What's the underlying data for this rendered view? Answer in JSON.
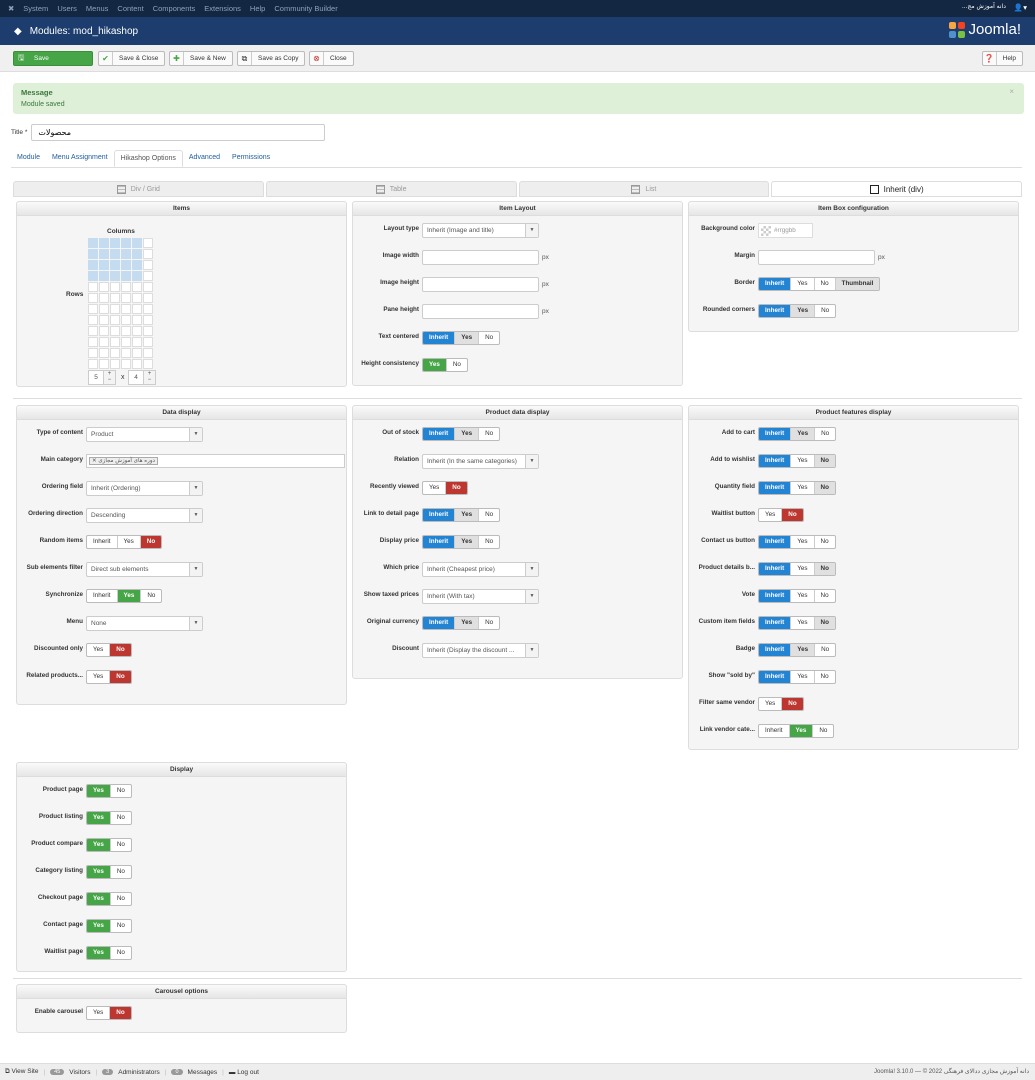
{
  "topnav": {
    "items": [
      "System",
      "Users",
      "Menus",
      "Content",
      "Components",
      "Extensions",
      "Help",
      "Community Builder"
    ],
    "site_name": "دانه آموزش مج...",
    "user_icon": "user-icon"
  },
  "header": {
    "title": "Modules: mod_hikashop",
    "logo": "Joomla!"
  },
  "toolbar": {
    "save": "Save",
    "save_close": "Save & Close",
    "save_new": "Save & New",
    "save_copy": "Save as Copy",
    "close": "Close",
    "help": "Help"
  },
  "message": {
    "heading": "Message",
    "text": "Module saved",
    "close": "×"
  },
  "title_field": {
    "label": "Title *",
    "value": "محصولات"
  },
  "tabs": [
    "Module",
    "Menu Assignment",
    "Hikashop Options",
    "Advanced",
    "Permissions"
  ],
  "active_tab": 2,
  "layout_tabs": [
    "Div / Grid",
    "Table",
    "List",
    "Inherit (div)"
  ],
  "active_layout_tab": 3,
  "colors": {
    "blue": "#2384d3",
    "green": "#46a546",
    "red": "#bd362f",
    "topbar": "#132743",
    "header": "#1c3d6e"
  },
  "items": {
    "title": "Items",
    "columns_label": "Columns",
    "rows_label": "Rows",
    "columns": 5,
    "rows": 4,
    "grid_cols": 6,
    "grid_rows": 12,
    "x": "x",
    "plus": "+",
    "minus": "−"
  },
  "item_layout": {
    "title": "Item Layout",
    "rows": [
      {
        "label": "Layout type",
        "type": "select",
        "value": "Inherit (Image and title)"
      },
      {
        "label": "Image width",
        "type": "input",
        "unit": "px"
      },
      {
        "label": "Image height",
        "type": "input",
        "unit": "px"
      },
      {
        "label": "Pane height",
        "type": "input",
        "unit": "px"
      },
      {
        "label": "Text centered",
        "type": "toggle",
        "options": [
          "Inherit",
          "Yes",
          "No"
        ],
        "selected": 0,
        "hint": 1
      },
      {
        "label": "Height consistency",
        "type": "toggle",
        "options": [
          "Yes",
          "No"
        ],
        "selected": 0
      }
    ]
  },
  "item_box": {
    "title": "Item Box configuration",
    "rows": [
      {
        "label": "Background color",
        "type": "color",
        "placeholder": "#rrggbb"
      },
      {
        "label": "Margin",
        "type": "input",
        "unit": "px"
      },
      {
        "label": "Border",
        "type": "toggle",
        "options": [
          "Inherit",
          "Yes",
          "No",
          "Thumbnail"
        ],
        "selected": 0,
        "hint": 3
      },
      {
        "label": "Rounded corners",
        "type": "toggle",
        "options": [
          "Inherit",
          "Yes",
          "No"
        ],
        "selected": 0,
        "hint": 1
      }
    ]
  },
  "data_display": {
    "title": "Data display",
    "rows": [
      {
        "label": "Type of content",
        "type": "select",
        "value": "Product"
      },
      {
        "label": "Main category",
        "type": "tags",
        "value": "دوره های آموزش مجازی"
      },
      {
        "label": "Ordering field",
        "type": "select",
        "value": "Inherit (Ordering)"
      },
      {
        "label": "Ordering direction",
        "type": "select",
        "value": "Descending"
      },
      {
        "label": "Random items",
        "type": "toggle",
        "options": [
          "Inherit",
          "Yes",
          "No"
        ],
        "selected": 2
      },
      {
        "label": "Sub elements filter",
        "type": "select",
        "value": "Direct sub elements"
      },
      {
        "label": "Synchronize",
        "type": "toggle",
        "options": [
          "Inherit",
          "Yes",
          "No"
        ],
        "selected": 1
      },
      {
        "label": "Menu",
        "type": "select",
        "value": "None"
      },
      {
        "label": "Discounted only",
        "type": "toggle",
        "options": [
          "Yes",
          "No"
        ],
        "selected": 1
      },
      {
        "label": "Related products...",
        "type": "toggle",
        "options": [
          "Yes",
          "No"
        ],
        "selected": 1
      }
    ]
  },
  "product_data": {
    "title": "Product data display",
    "rows": [
      {
        "label": "Out of stock",
        "type": "toggle",
        "options": [
          "Inherit",
          "Yes",
          "No"
        ],
        "selected": 0,
        "hint": 1
      },
      {
        "label": "Relation",
        "type": "select",
        "value": "Inherit (In the same categories)"
      },
      {
        "label": "Recently viewed",
        "type": "toggle",
        "options": [
          "Yes",
          "No"
        ],
        "selected": 1
      },
      {
        "label": "Link to detail page",
        "type": "toggle",
        "options": [
          "Inherit",
          "Yes",
          "No"
        ],
        "selected": 0,
        "hint": 1
      },
      {
        "label": "Display price",
        "type": "toggle",
        "options": [
          "Inherit",
          "Yes",
          "No"
        ],
        "selected": 0,
        "hint": 1
      },
      {
        "label": "Which price",
        "type": "select",
        "value": "Inherit (Cheapest price)"
      },
      {
        "label": "Show taxed prices",
        "type": "select",
        "value": "Inherit (With tax)"
      },
      {
        "label": "Original currency",
        "type": "toggle",
        "options": [
          "Inherit",
          "Yes",
          "No"
        ],
        "selected": 0,
        "hint": 1
      },
      {
        "label": "Discount",
        "type": "select",
        "value": "Inherit (Display the discount ..."
      }
    ]
  },
  "features": {
    "title": "Product features display",
    "rows": [
      {
        "label": "Add to cart",
        "type": "toggle",
        "options": [
          "Inherit",
          "Yes",
          "No"
        ],
        "selected": 0,
        "hint": 1
      },
      {
        "label": "Add to wishlist",
        "type": "toggle",
        "options": [
          "Inherit",
          "Yes",
          "No"
        ],
        "selected": 0,
        "hint": 2
      },
      {
        "label": "Quantity field",
        "type": "toggle",
        "options": [
          "Inherit",
          "Yes",
          "No"
        ],
        "selected": 0,
        "hint": 2
      },
      {
        "label": "Waitlist button",
        "type": "toggle",
        "options": [
          "Yes",
          "No"
        ],
        "selected": 1
      },
      {
        "label": "Contact us button",
        "type": "toggle",
        "options": [
          "Inherit",
          "Yes",
          "No"
        ],
        "selected": 0
      },
      {
        "label": "Product details b...",
        "type": "toggle",
        "options": [
          "Inherit",
          "Yes",
          "No"
        ],
        "selected": 0,
        "hint": 2
      },
      {
        "label": "Vote",
        "type": "toggle",
        "options": [
          "Inherit",
          "Yes",
          "No"
        ],
        "selected": 0
      },
      {
        "label": "Custom item fields",
        "type": "toggle",
        "options": [
          "Inherit",
          "Yes",
          "No"
        ],
        "selected": 0,
        "hint": 2
      },
      {
        "label": "Badge",
        "type": "toggle",
        "options": [
          "Inherit",
          "Yes",
          "No"
        ],
        "selected": 0,
        "hint": 1
      },
      {
        "label": "Show \"sold by\"",
        "type": "toggle",
        "options": [
          "Inherit",
          "Yes",
          "No"
        ],
        "selected": 0
      },
      {
        "label": "Filter same vendor",
        "type": "toggle",
        "options": [
          "Yes",
          "No"
        ],
        "selected": 1
      },
      {
        "label": "Link vendor cate...",
        "type": "toggle",
        "options": [
          "Inherit",
          "Yes",
          "No"
        ],
        "selected": 1
      }
    ]
  },
  "display": {
    "title": "Display",
    "rows": [
      {
        "label": "Product page",
        "type": "toggle",
        "options": [
          "Yes",
          "No"
        ],
        "selected": 0
      },
      {
        "label": "Product listing",
        "type": "toggle",
        "options": [
          "Yes",
          "No"
        ],
        "selected": 0
      },
      {
        "label": "Product compare",
        "type": "toggle",
        "options": [
          "Yes",
          "No"
        ],
        "selected": 0
      },
      {
        "label": "Category listing",
        "type": "toggle",
        "options": [
          "Yes",
          "No"
        ],
        "selected": 0
      },
      {
        "label": "Checkout page",
        "type": "toggle",
        "options": [
          "Yes",
          "No"
        ],
        "selected": 0
      },
      {
        "label": "Contact page",
        "type": "toggle",
        "options": [
          "Yes",
          "No"
        ],
        "selected": 0
      },
      {
        "label": "Waitlist page",
        "type": "toggle",
        "options": [
          "Yes",
          "No"
        ],
        "selected": 0
      }
    ]
  },
  "carousel": {
    "title": "Carousel options",
    "rows": [
      {
        "label": "Enable carousel",
        "type": "toggle",
        "options": [
          "Yes",
          "No"
        ],
        "selected": 1
      }
    ]
  },
  "footer": {
    "view_site": "View Site",
    "visitors_count": "45",
    "visitors": "Visitors",
    "admins_count": "3",
    "admins": "Administrators",
    "messages_count": "0",
    "messages": "Messages",
    "logout": "Log out",
    "version": "Joomla! 3.10.0 — © 2022 دانه آموزش مجازی ددالای فرهنگی"
  }
}
